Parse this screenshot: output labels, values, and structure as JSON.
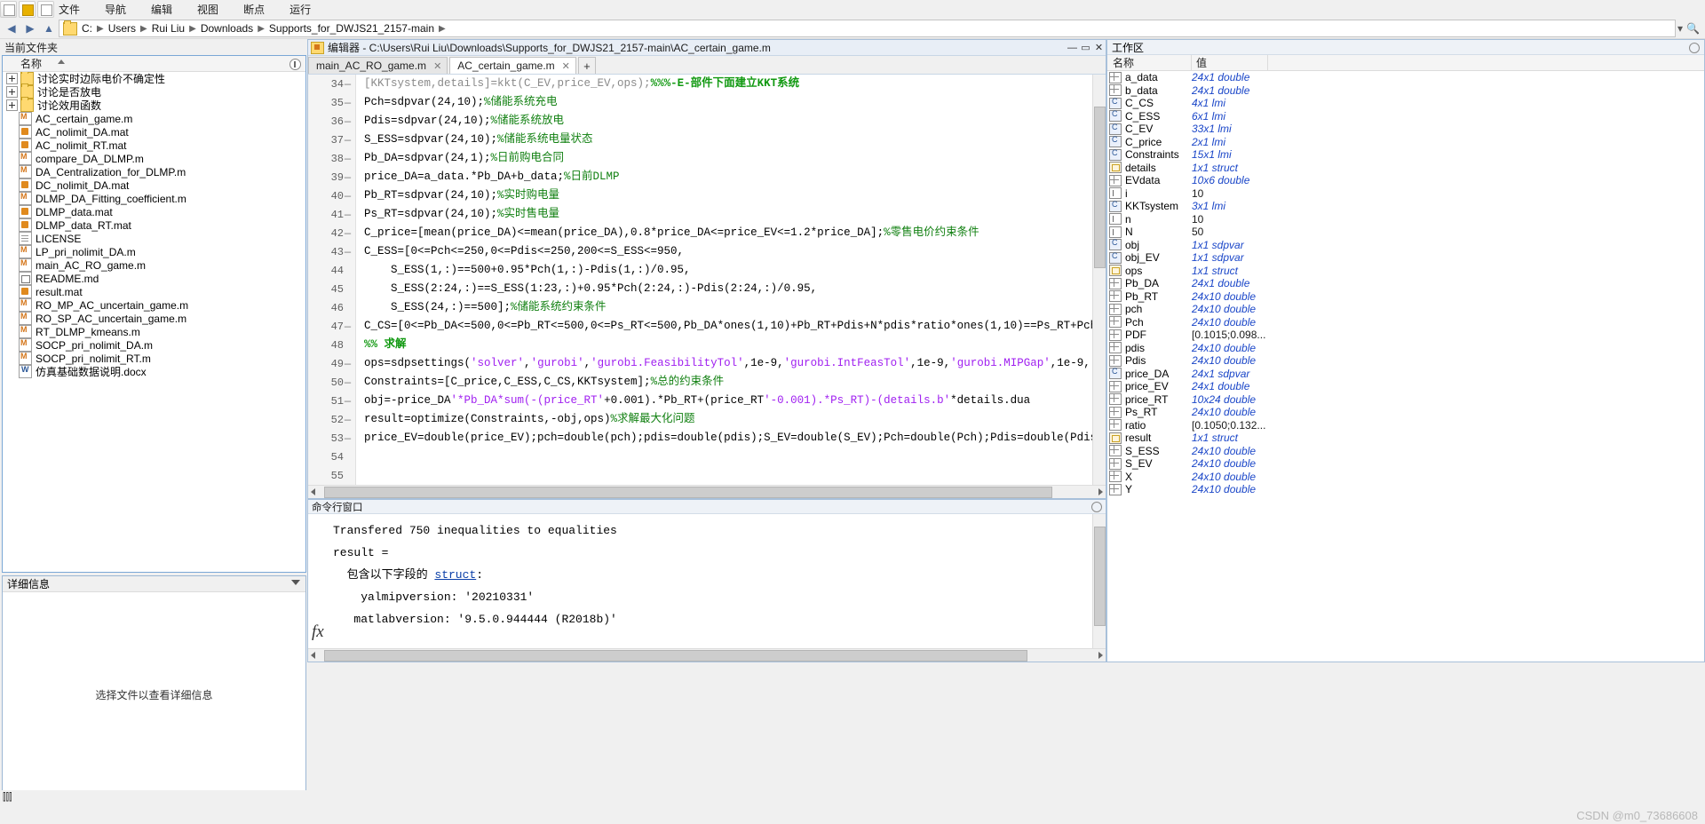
{
  "toolbar": {
    "tabs": [
      "文件",
      "导航",
      "编辑",
      "视图",
      "断点",
      "运行"
    ]
  },
  "address": {
    "crumbs": [
      "C:",
      "Users",
      "Rui Liu",
      "Downloads",
      "Supports_for_DWJS21_2157-main"
    ],
    "separator": "▶"
  },
  "left_panel": {
    "title": "当前文件夹",
    "column_header": "名称",
    "files": [
      {
        "label": "讨论实时边际电价不确定性",
        "icon": "folder",
        "expandable": true
      },
      {
        "label": "讨论是否放电",
        "icon": "folder",
        "expandable": true
      },
      {
        "label": "讨论效用函数",
        "icon": "folder",
        "expandable": true
      },
      {
        "label": "AC_certain_game.m",
        "icon": "m-file",
        "expandable": false
      },
      {
        "label": "AC_nolimit_DA.mat",
        "icon": "mat-file",
        "expandable": false
      },
      {
        "label": "AC_nolimit_RT.mat",
        "icon": "mat-file",
        "expandable": false
      },
      {
        "label": "compare_DA_DLMP.m",
        "icon": "m-file",
        "expandable": false
      },
      {
        "label": "DA_Centralization_for_DLMP.m",
        "icon": "m-file",
        "expandable": false
      },
      {
        "label": "DC_nolimit_DA.mat",
        "icon": "mat-file",
        "expandable": false
      },
      {
        "label": "DLMP_DA_Fitting_coefficient.m",
        "icon": "m-file",
        "expandable": false
      },
      {
        "label": "DLMP_data.mat",
        "icon": "mat-file",
        "expandable": false
      },
      {
        "label": "DLMP_data_RT.mat",
        "icon": "mat-file",
        "expandable": false
      },
      {
        "label": "LICENSE",
        "icon": "doc",
        "expandable": false
      },
      {
        "label": "LP_pri_nolimit_DA.m",
        "icon": "m-file",
        "expandable": false
      },
      {
        "label": "main_AC_RO_game.m",
        "icon": "m-file",
        "expandable": false
      },
      {
        "label": "README.md",
        "icon": "md",
        "expandable": false
      },
      {
        "label": "result.mat",
        "icon": "mat-file",
        "expandable": false
      },
      {
        "label": "RO_MP_AC_uncertain_game.m",
        "icon": "m-file",
        "expandable": false
      },
      {
        "label": "RO_SP_AC_uncertain_game.m",
        "icon": "m-file",
        "expandable": false
      },
      {
        "label": "RT_DLMP_kmeans.m",
        "icon": "m-file",
        "expandable": false
      },
      {
        "label": "SOCP_pri_nolimit_DA.m",
        "icon": "m-file",
        "expandable": false
      },
      {
        "label": "SOCP_pri_nolimit_RT.m",
        "icon": "m-file",
        "expandable": false
      },
      {
        "label": "仿真基础数据说明.docx",
        "icon": "docx",
        "expandable": false
      }
    ],
    "details_title": "详细信息",
    "details_placeholder": "选择文件以查看详细信息",
    "status": "⫿⫿⫿"
  },
  "editor": {
    "window_title": "编辑器 - C:\\Users\\Rui Liu\\Downloads\\Supports_for_DWJS21_2157-main\\AC_certain_game.m",
    "tabs": [
      {
        "label": "main_AC_RO_game.m",
        "active": false,
        "close": "✕"
      },
      {
        "label": "AC_certain_game.m",
        "active": true,
        "close": "✕"
      }
    ],
    "add_tab": "+",
    "minimize": "—",
    "maximize": "▭",
    "close": "✕",
    "lines": [
      {
        "num": "34",
        "dash": true,
        "partial": true,
        "text": "[KKTsystem,details]=kkt(C_EV,price_EV,ops);%%%-E-部件下面建立KKT系统"
      },
      {
        "num": "35",
        "dash": true,
        "text": "Pch=sdpvar(24,10);%储能系统充电"
      },
      {
        "num": "36",
        "dash": true,
        "text": "Pdis=sdpvar(24,10);%储能系统放电"
      },
      {
        "num": "37",
        "dash": true,
        "text": "S_ESS=sdpvar(24,10);%储能系统电量状态"
      },
      {
        "num": "38",
        "dash": true,
        "text": "Pb_DA=sdpvar(24,1);%日前购电合同"
      },
      {
        "num": "39",
        "dash": true,
        "text": "price_DA=a_data.*Pb_DA+b_data;%日前DLMP"
      },
      {
        "num": "40",
        "dash": true,
        "text": "Pb_RT=sdpvar(24,10);%实时购电量"
      },
      {
        "num": "41",
        "dash": true,
        "text": "Ps_RT=sdpvar(24,10);%实时售电量"
      },
      {
        "num": "42",
        "dash": true,
        "text": "C_price=[mean(price_DA)<=mean(price_DA),0.8*price_DA<=price_EV<=1.2*price_DA];%零售电价约束条件"
      },
      {
        "num": "43",
        "dash": true,
        "text": "C_ESS=[0<=Pch<=250,0<=Pdis<=250,200<=S_ESS<=950,"
      },
      {
        "num": "44",
        "dash": false,
        "text": "    S_ESS(1,:)==500+0.95*Pch(1,:)-Pdis(1,:)/0.95,"
      },
      {
        "num": "45",
        "dash": false,
        "text": "    S_ESS(2:24,:)==S_ESS(1:23,:)+0.95*Pch(2:24,:)-Pdis(2:24,:)/0.95,"
      },
      {
        "num": "46",
        "dash": false,
        "text": "    S_ESS(24,:)==500];%储能系统约束条件"
      },
      {
        "num": "47",
        "dash": true,
        "text": "C_CS=[0<=Pb_DA<=500,0<=Pb_RT<=500,0<=Ps_RT<=500,Pb_DA*ones(1,10)+Pb_RT+Pdis+N*pdis*ratio*ones(1,10)==Ps_RT+Pch"
      },
      {
        "num": "48",
        "dash": false,
        "text": "%% 求解"
      },
      {
        "num": "49",
        "dash": true,
        "text": "ops=sdpsettings('solver','gurobi','gurobi.FeasibilityTol',1e-9,'gurobi.IntFeasTol',1e-9,'gurobi.MIPGap',1e-9,'"
      },
      {
        "num": "50",
        "dash": true,
        "text": "Constraints=[C_price,C_ESS,C_CS,KKTsystem];%总的约束条件"
      },
      {
        "num": "51",
        "dash": true,
        "text": "obj=-price_DA'*Pb_DA*sum(-(price_RT'+0.001).*Pb_RT+(price_RT'-0.001).*Ps_RT)-(details.b'*details.dua"
      },
      {
        "num": "52",
        "dash": true,
        "text": "result=optimize(Constraints,-obj,ops)%求解最大化问题"
      },
      {
        "num": "53",
        "dash": true,
        "text": "price_EV=double(price_EV);pch=double(pch);pdis=double(pdis);S_EV=double(S_EV);Pch=double(Pch);Pdis=double(Pdis"
      },
      {
        "num": "54",
        "dash": false,
        "text": ""
      },
      {
        "num": "55",
        "dash": false,
        "text": ""
      }
    ]
  },
  "command_window": {
    "title": "命令行窗口",
    "lines": [
      "Transfered 750 inequalities to equalities",
      "",
      "result =",
      "",
      "  包含以下字段的 struct:",
      "",
      "    yalmipversion: '20210331'",
      "   matlabversion: '9.5.0.944444 (R2018b)'"
    ],
    "struct_keyword": "struct",
    "prompt_icon": "fx"
  },
  "workspace": {
    "title": "工作区",
    "columns": [
      "名称",
      "值",
      ""
    ],
    "variables": [
      {
        "name": "a_data",
        "value": "24x1 double",
        "italic": true,
        "icon": "grid"
      },
      {
        "name": "b_data",
        "value": "24x1 double",
        "italic": true,
        "icon": "grid"
      },
      {
        "name": "C_CS",
        "value": "4x1 lmi",
        "italic": true,
        "icon": "obj"
      },
      {
        "name": "C_ESS",
        "value": "6x1 lmi",
        "italic": true,
        "icon": "obj"
      },
      {
        "name": "C_EV",
        "value": "33x1 lmi",
        "italic": true,
        "icon": "obj"
      },
      {
        "name": "C_price",
        "value": "2x1 lmi",
        "italic": true,
        "icon": "obj"
      },
      {
        "name": "Constraints",
        "value": "15x1 lmi",
        "italic": true,
        "icon": "obj"
      },
      {
        "name": "details",
        "value": "1x1 struct",
        "italic": true,
        "icon": "st"
      },
      {
        "name": "EVdata",
        "value": "10x6 double",
        "italic": true,
        "icon": "grid"
      },
      {
        "name": "i",
        "value": "10",
        "italic": false,
        "icon": "num"
      },
      {
        "name": "KKTsystem",
        "value": "3x1 lmi",
        "italic": true,
        "icon": "obj"
      },
      {
        "name": "n",
        "value": "10",
        "italic": false,
        "icon": "num"
      },
      {
        "name": "N",
        "value": "50",
        "italic": false,
        "icon": "num"
      },
      {
        "name": "obj",
        "value": "1x1 sdpvar",
        "italic": true,
        "icon": "obj"
      },
      {
        "name": "obj_EV",
        "value": "1x1 sdpvar",
        "italic": true,
        "icon": "obj"
      },
      {
        "name": "ops",
        "value": "1x1 struct",
        "italic": true,
        "icon": "st"
      },
      {
        "name": "Pb_DA",
        "value": "24x1 double",
        "italic": true,
        "icon": "grid"
      },
      {
        "name": "Pb_RT",
        "value": "24x10 double",
        "italic": true,
        "icon": "grid"
      },
      {
        "name": "pch",
        "value": "24x10 double",
        "italic": true,
        "icon": "grid"
      },
      {
        "name": "Pch",
        "value": "24x10 double",
        "italic": true,
        "icon": "grid"
      },
      {
        "name": "PDF",
        "value": "[0.1015;0.098...",
        "italic": false,
        "icon": "grid"
      },
      {
        "name": "pdis",
        "value": "24x10 double",
        "italic": true,
        "icon": "grid"
      },
      {
        "name": "Pdis",
        "value": "24x10 double",
        "italic": true,
        "icon": "grid"
      },
      {
        "name": "price_DA",
        "value": "24x1 sdpvar",
        "italic": true,
        "icon": "obj"
      },
      {
        "name": "price_EV",
        "value": "24x1 double",
        "italic": true,
        "icon": "grid"
      },
      {
        "name": "price_RT",
        "value": "10x24 double",
        "italic": true,
        "icon": "grid"
      },
      {
        "name": "Ps_RT",
        "value": "24x10 double",
        "italic": true,
        "icon": "grid"
      },
      {
        "name": "ratio",
        "value": "[0.1050;0.132...",
        "italic": false,
        "icon": "grid"
      },
      {
        "name": "result",
        "value": "1x1 struct",
        "italic": true,
        "icon": "st"
      },
      {
        "name": "S_ESS",
        "value": "24x10 double",
        "italic": true,
        "icon": "grid"
      },
      {
        "name": "S_EV",
        "value": "24x10 double",
        "italic": true,
        "icon": "grid"
      },
      {
        "name": "X",
        "value": "24x10 double",
        "italic": true,
        "icon": "grid"
      },
      {
        "name": "Y",
        "value": "24x10 double",
        "italic": true,
        "icon": "grid"
      }
    ]
  },
  "watermark": "CSDN @m0_73686608"
}
